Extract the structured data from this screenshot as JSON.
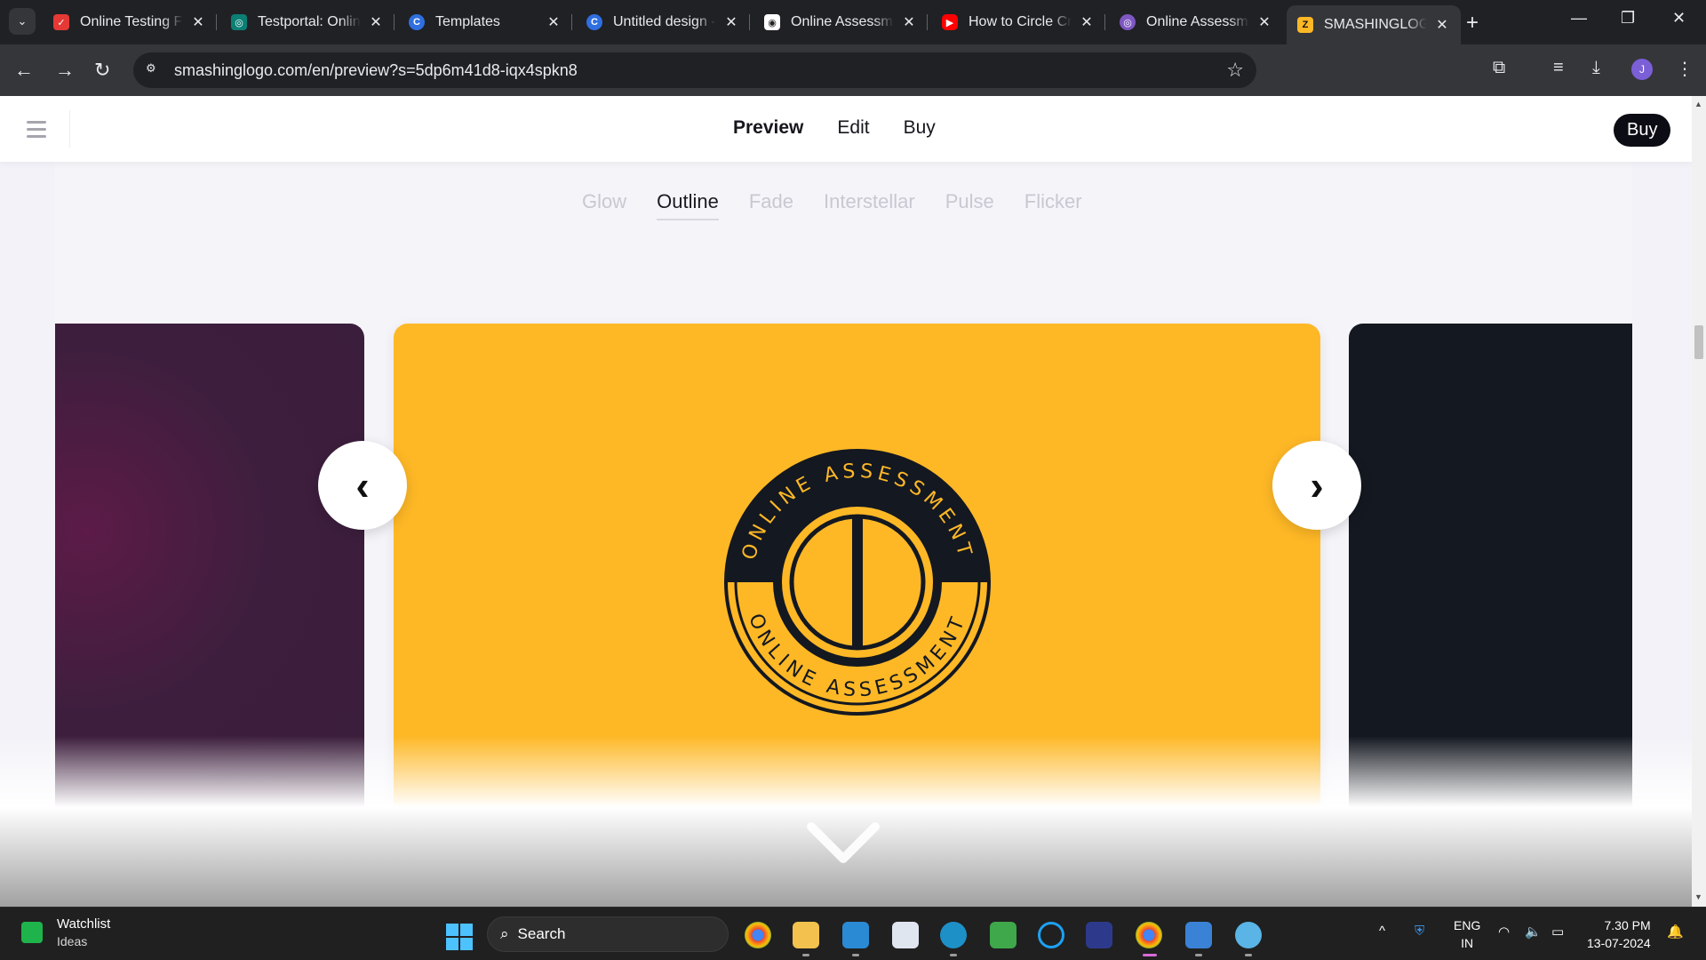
{
  "browser": {
    "tabs": [
      {
        "title": "Online Testing Fr",
        "favicon_color": "#e53935"
      },
      {
        "title": "Testportal: Online",
        "favicon_color": "#0b7f74"
      },
      {
        "title": "Templates",
        "favicon_color": "#2f6fe0"
      },
      {
        "title": "Untitled design -",
        "favicon_color": "#2f6fe0"
      },
      {
        "title": "Online Assessme",
        "favicon_color": "#ffffff"
      },
      {
        "title": "How to Circle Cr",
        "favicon_color": "#ff0000"
      },
      {
        "title": "Online Assessme",
        "favicon_color": "#7e57c2"
      },
      {
        "title": "SMASHINGLOGO",
        "favicon_color": "#feb826"
      }
    ],
    "active_tab_index": 7,
    "url": "smashinglogo.com/en/preview?s=5dp6m41d8-iqx4spkn8",
    "profile_initial": "J"
  },
  "site": {
    "nav": {
      "preview": "Preview",
      "edit": "Edit",
      "buy": "Buy"
    },
    "buy_button": "Buy",
    "effects": [
      "Glow",
      "Outline",
      "Fade",
      "Interstellar",
      "Pulse",
      "Flicker"
    ],
    "active_effect": "Outline",
    "logo": {
      "top_text": "ONLINE ASSESSMENT",
      "bottom_text": "ONLINE ASSESSMENT"
    },
    "colors": {
      "accent": "#feb826",
      "dark": "#141820",
      "purple": "#3d1e3d"
    }
  },
  "taskbar": {
    "weather_title": "Watchlist",
    "weather_sub": "Ideas",
    "search_label": "Search",
    "lang_line1": "ENG",
    "lang_line2": "IN",
    "time": "7.30 PM",
    "date": "13-07-2024"
  }
}
